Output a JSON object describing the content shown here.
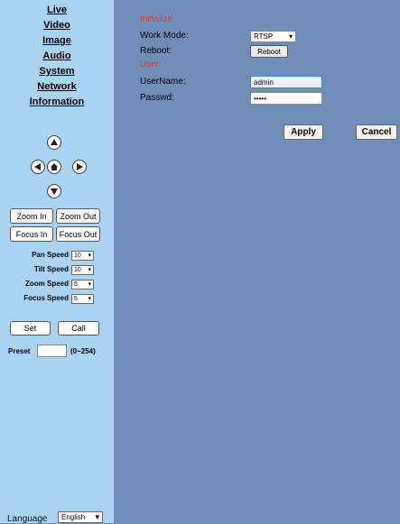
{
  "nav": {
    "items": [
      {
        "label": "Live"
      },
      {
        "label": "Video"
      },
      {
        "label": "Image"
      },
      {
        "label": "Audio"
      },
      {
        "label": "System"
      },
      {
        "label": "Network"
      },
      {
        "label": "Information"
      }
    ]
  },
  "ptz": {
    "icons": [
      "up-arrow-icon",
      "left-arrow-icon",
      "home-icon",
      "right-arrow-icon",
      "down-arrow-icon"
    ],
    "zoom_in": "Zoom In",
    "zoom_out": "Zoom Out",
    "focus_in": "Focus In",
    "focus_out": "Focus Out",
    "pan_speed_label": "Pan Speed",
    "pan_speed_value": "10",
    "tilt_speed_label": "Tilt Speed",
    "tilt_speed_value": "10",
    "zoom_speed_label": "Zoom Speed",
    "zoom_speed_value": "5",
    "focus_speed_label": "Focus Speed",
    "focus_speed_value": "5",
    "set_label": "Set",
    "call_label": "Call",
    "preset_label": "Preset",
    "preset_value": "",
    "preset_range": "(0~254)"
  },
  "language": {
    "label": "Language",
    "value": "English"
  },
  "form": {
    "initialize_heading": "Initialize",
    "work_mode_label": "Work Mode:",
    "work_mode_value": "RTSP",
    "reboot_label": "Reboot:",
    "reboot_button": "Reboot",
    "user_heading": "User",
    "username_label": "UserName:",
    "username_value": "admin",
    "password_label": "Passwd:",
    "password_value": "•••••",
    "apply_button": "Apply",
    "cancel_button": "Cancel"
  },
  "colors": {
    "sidebar_bg": "#a9d4f3",
    "main_bg": "#6f8fb9",
    "section_heading": "#e43b2f",
    "username_field_bg": "#e9f1ff"
  }
}
